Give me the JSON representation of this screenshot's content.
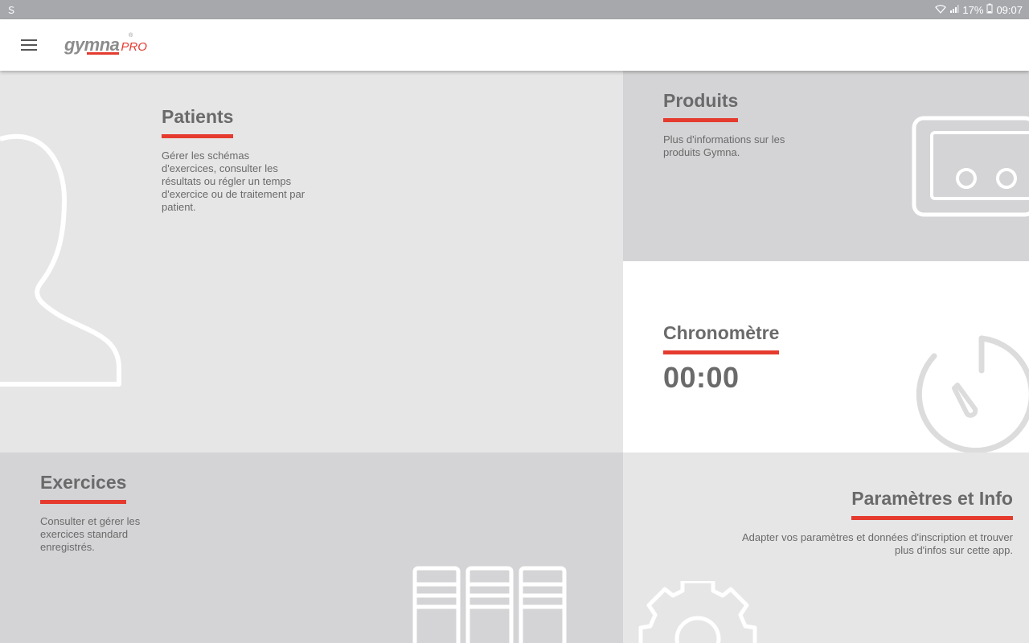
{
  "statusbar": {
    "left_icon": "s-app-icon",
    "battery": "17%",
    "time": "09:07"
  },
  "appbar": {
    "menu_icon": "hamburger-menu-icon",
    "logo_brand": "gymna",
    "logo_suffix": "PRO",
    "logo_reg": "®"
  },
  "tiles": {
    "patients": {
      "title": "Patients",
      "description": "Gérer les schémas d'exercices, consulter les résultats ou régler un temps d'exercice ou de traitement par patient.",
      "icon": "person-silhouette-icon"
    },
    "produits": {
      "title": "Produits",
      "description": "Plus d'informations sur les produits Gymna.",
      "icon": "device-icon"
    },
    "chrono": {
      "title": "Chronomètre",
      "time": "00:00",
      "icon": "stopwatch-icon"
    },
    "exercices": {
      "title": "Exercices",
      "description": "Consulter et gérer les exercices standard enregistrés.",
      "icon": "binders-icon"
    },
    "params": {
      "title": "Paramètres et Info",
      "description": "Adapter vos paramètres et données d'inscription et trouver plus d'infos sur cette app.",
      "icon": "gear-icon"
    }
  },
  "colors": {
    "accent": "#e53b2f",
    "statusbar": "#a7a8ac",
    "tile_light": "#e6e6e6",
    "tile_dark": "#d4d4d6",
    "text": "#6a6a6a"
  }
}
